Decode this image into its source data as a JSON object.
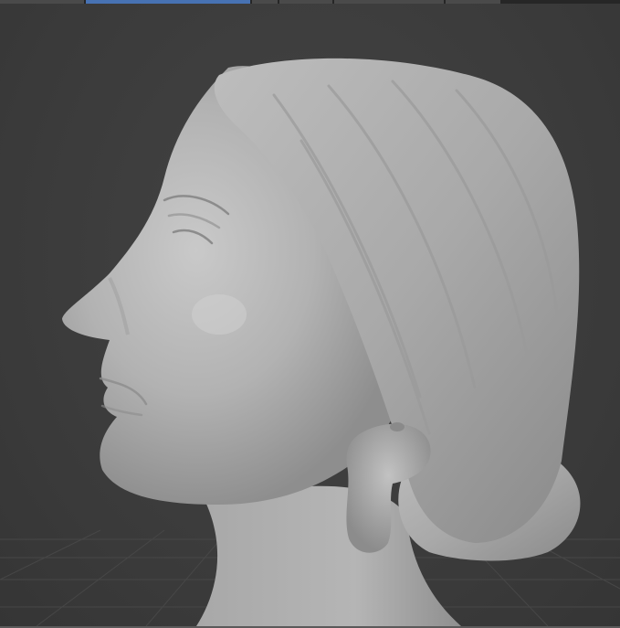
{
  "top_strip": {
    "segments": [
      {
        "name": "editor-tab-1",
        "active": false
      },
      {
        "name": "editor-tab-2",
        "active": true
      },
      {
        "name": "editor-tab-3",
        "active": false
      },
      {
        "name": "editor-tab-4",
        "active": false
      },
      {
        "name": "editor-tab-5",
        "active": false
      },
      {
        "name": "editor-tab-6",
        "active": false
      }
    ],
    "accent_color": "#4772b3"
  },
  "viewport": {
    "background_color": "#3d3d3d",
    "grid_color": "#474747",
    "model_color": "#b4b4b4",
    "shading": "solid"
  }
}
